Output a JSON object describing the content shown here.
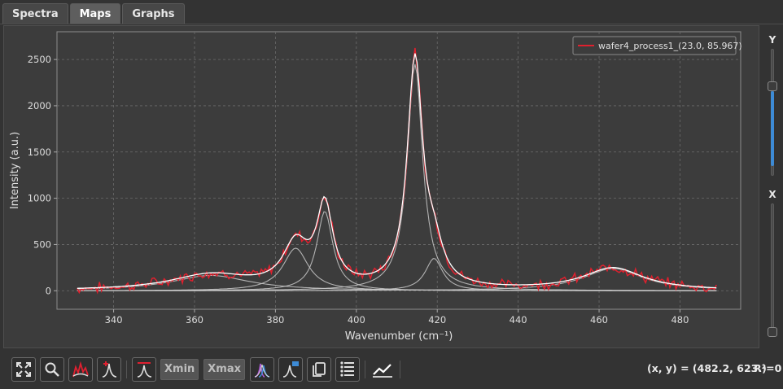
{
  "tabs": [
    {
      "label": "Spectra",
      "active": false
    },
    {
      "label": "Maps",
      "active": true
    },
    {
      "label": "Graphs",
      "active": false
    }
  ],
  "sliders": {
    "y_label": "Y",
    "x_label": "X",
    "y_level": 0.72,
    "x_level": 0.0
  },
  "toolbar": {
    "xmin_placeholder": "Xmin",
    "xmax_placeholder": "Xmax",
    "coords_text": "(x, y) = (482.2, 623.)",
    "r2_text": "R²=0"
  },
  "colors": {
    "background": "#333333",
    "plot_area": "#3c3c3c",
    "measured": "#e0202e",
    "fit": "#ffffff",
    "accent": "#3d8bd6"
  },
  "chart_data": {
    "type": "line",
    "xlabel": "Wavenumber (cm⁻¹)",
    "ylabel": "Intensity (a.u.)",
    "xlim": [
      326,
      495
    ],
    "ylim": [
      -200,
      2800
    ],
    "xticks": [
      340,
      360,
      380,
      400,
      420,
      440,
      460,
      480
    ],
    "yticks": [
      0,
      500,
      1000,
      1500,
      2000,
      2500
    ],
    "grid": true,
    "legend": {
      "placement": "top-right",
      "entries": [
        "wafer4_process1_(23.0, 85.967)"
      ]
    },
    "x_range": [
      331,
      489
    ],
    "peaks": [
      {
        "center": 364,
        "height": 165,
        "hwhm": 12
      },
      {
        "center": 385,
        "height": 460,
        "hwhm": 3.8
      },
      {
        "center": 392.2,
        "height": 860,
        "hwhm": 2.4
      },
      {
        "center": 414.5,
        "height": 2450,
        "hwhm": 2.3
      },
      {
        "center": 419.2,
        "height": 350,
        "hwhm": 2.6
      },
      {
        "center": 463.5,
        "height": 240,
        "hwhm": 9
      }
    ],
    "series": [
      {
        "name": "wafer4_process1_(23.0, 85.967)",
        "role": "measured",
        "noise_amplitude": 45
      },
      {
        "role": "fit",
        "color": "#ffffff"
      }
    ]
  }
}
